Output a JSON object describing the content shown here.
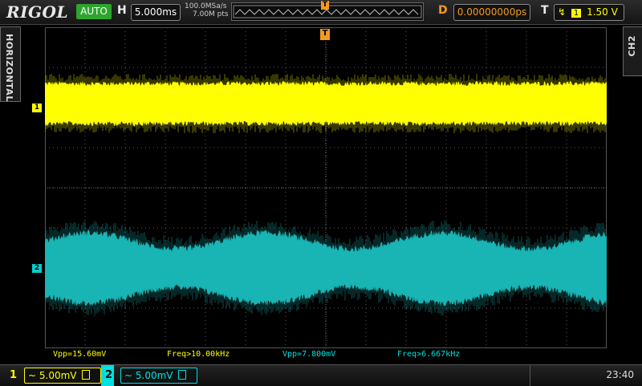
{
  "header": {
    "brand": "RIGOL",
    "run_mode": "AUTO",
    "horizontal_label": "H",
    "timebase": "5.000ms",
    "sample_rate": "100.0MSa/s",
    "memory_depth": "7.00M pts",
    "trigger_position_marker": "T",
    "delay_label": "D",
    "delay_value": "0.00000000ps",
    "trigger_label": "T",
    "trigger_channel": "1",
    "trigger_level": "1.50 V"
  },
  "side": {
    "left_tab": "HORIZONTAL",
    "right_tab": "CH2"
  },
  "screen": {
    "trigger_marker": "T",
    "ch1_marker": "1",
    "ch2_marker": "2"
  },
  "measurements": {
    "ch1_vpp": "Vpp=15.60mV",
    "ch1_freq": "Freq>10.00kHz",
    "ch2_vpp": "Vpp=7.800mV",
    "ch2_freq": "Freq>6.667kHz"
  },
  "channels": [
    {
      "number": "1",
      "coupling_symbol": "~",
      "scale": "5.00mV",
      "color": "#ffff00"
    },
    {
      "number": "2",
      "coupling_symbol": "~",
      "scale": "5.00mV",
      "color": "#00e0e0"
    }
  ],
  "clock": "23:40",
  "colors": {
    "ch1": "#ffff00",
    "ch2": "#1fb8b8",
    "accent": "#f39a1e",
    "run_green": "#2ea52e"
  }
}
